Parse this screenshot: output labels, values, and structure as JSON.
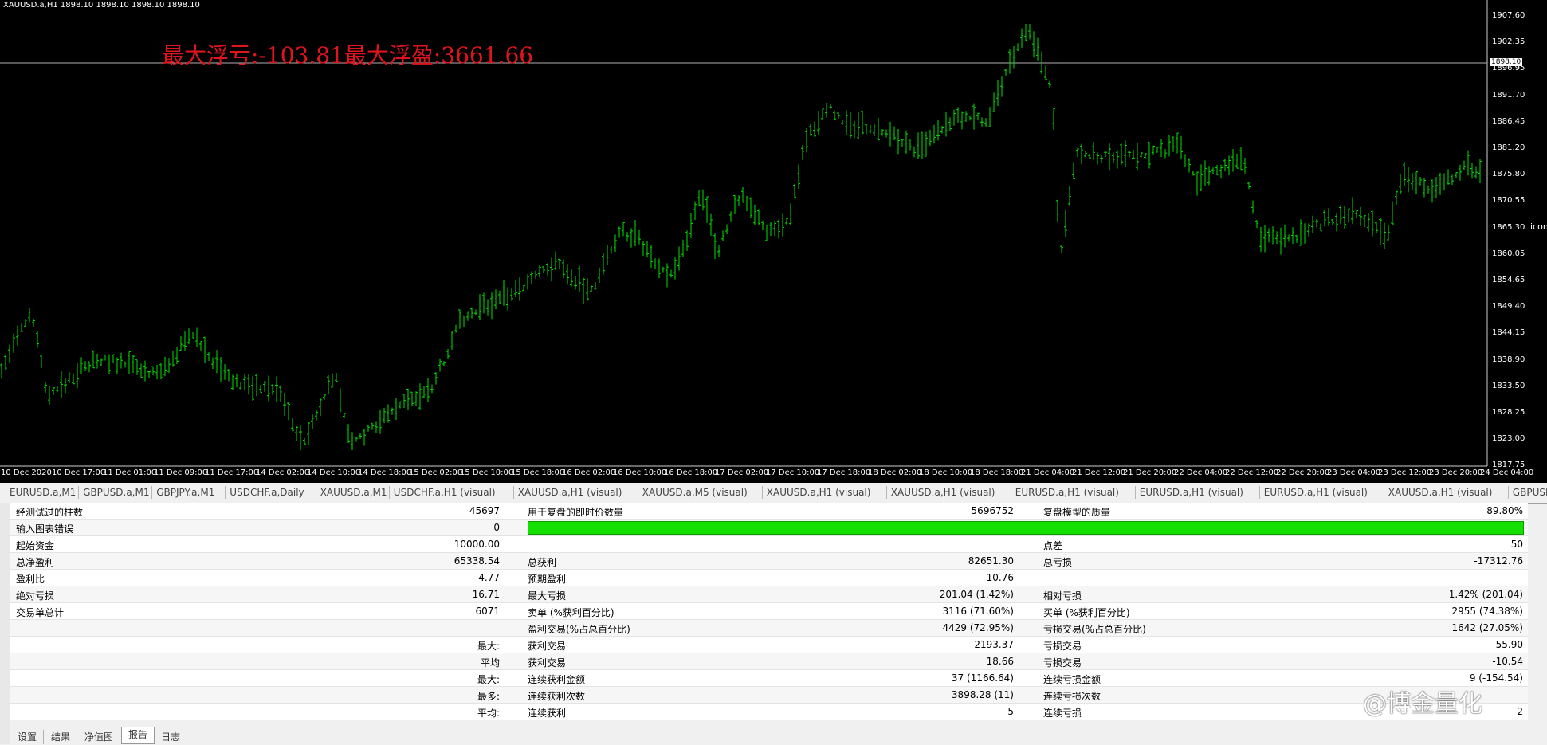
{
  "chart": {
    "header": "XAUUSD.a,H1  1898.10 1898.10 1898.10 1898.10",
    "overlay_text": "最大浮亏:-103.81最大浮盈:3661.66",
    "current_price": "1898.10",
    "price_ticks": [
      "1907.60",
      "1902.35",
      "1896.95",
      "1891.70",
      "1886.45",
      "1881.20",
      "1875.80",
      "1870.55",
      "1865.30",
      "1860.05",
      "1854.65",
      "1849.40",
      "1844.15",
      "1838.90",
      "1833.50",
      "1828.25",
      "1823.00",
      "1817.75"
    ],
    "time_ticks": [
      "10 Dec 2020",
      "10 Dec 17:00",
      "11 Dec 01:00",
      "11 Dec 09:00",
      "11 Dec 17:00",
      "14 Dec 02:00",
      "14 Dec 10:00",
      "14 Dec 18:00",
      "15 Dec 02:00",
      "15 Dec 10:00",
      "15 Dec 18:00",
      "16 Dec 02:00",
      "16 Dec 10:00",
      "16 Dec 18:00",
      "17 Dec 02:00",
      "17 Dec 10:00",
      "17 Dec 18:00",
      "18 Dec 02:00",
      "18 Dec 10:00",
      "18 Dec 18:00",
      "21 Dec 04:00",
      "21 Dec 12:00",
      "21 Dec 20:00",
      "22 Dec 04:00",
      "22 Dec 12:00",
      "22 Dec 20:00",
      "23 Dec 04:00",
      "23 Dec 12:00",
      "23 Dec 20:00",
      "24 Dec 04:00"
    ],
    "bar_color": "#00e000",
    "right_fragment": "icon"
  },
  "chart_tabs": [
    "EURUSD.a,M1",
    "GBPUSD.a,M1",
    "GBPJPY.a,M1",
    "USDCHF.a,Daily",
    "XAUUSD.a,M1",
    "USDCHF.a,H1 (visual)",
    "XAUUSD.a,H1 (visual)",
    "XAUUSD.a,M5 (visual)",
    "XAUUSD.a,H1 (visual)",
    "XAUUSD.a,H1 (visual)",
    "EURUSD.a,H1 (visual)",
    "EURUSD.a,H1 (visual)",
    "EURUSD.a,H1 (visual)",
    "XAUUSD.a,H1 (visual)",
    "GBPUSE"
  ],
  "report": {
    "rows": [
      {
        "l1": "经测试过的柱数",
        "v1": "45697",
        "l2": "用于复盘的即时价数量",
        "v2": "5696752",
        "l3": "复盘模型的质量",
        "v3": "89.80%"
      },
      {
        "l1": "输入图表错误",
        "v1": "0",
        "l2": "",
        "v2": "",
        "l3": "",
        "v3": "",
        "bar": true
      },
      {
        "l1": "起始资金",
        "v1": "10000.00",
        "l2": "",
        "v2": "",
        "l3": "点差",
        "v3": "50"
      },
      {
        "l1": "总净盈利",
        "v1": "65338.54",
        "l2": "总获利",
        "v2": "82651.30",
        "l3": "总亏损",
        "v3": "-17312.76"
      },
      {
        "l1": "盈利比",
        "v1": "4.77",
        "l2": "预期盈利",
        "v2": "10.76",
        "l3": "",
        "v3": ""
      },
      {
        "l1": "绝对亏损",
        "v1": "16.71",
        "l2": "最大亏损",
        "v2": "201.04 (1.42%)",
        "l3": "相对亏损",
        "v3": "1.42% (201.04)"
      },
      {
        "l1": "交易单总计",
        "v1": "6071",
        "l2": "卖单 (%获利百分比)",
        "v2": "3116 (71.60%)",
        "l3": "买单 (%获利百分比)",
        "v3": "2955 (74.38%)"
      },
      {
        "l1": "",
        "v1": "",
        "l2": "盈利交易(%占总百分比)",
        "v2": "4429 (72.95%)",
        "l3": "亏损交易(%占总百分比)",
        "v3": "1642 (27.05%)"
      },
      {
        "l1": "",
        "v1": "最大:",
        "l2": "获利交易",
        "v2": "2193.37",
        "l3": "亏损交易",
        "v3": "-55.90"
      },
      {
        "l1": "",
        "v1": "平均",
        "l2": "获利交易",
        "v2": "18.66",
        "l3": "亏损交易",
        "v3": "-10.54"
      },
      {
        "l1": "",
        "v1": "最大:",
        "l2": "连续获利金额",
        "v2": "37 (1166.64)",
        "l3": "连续亏损金额",
        "v3": "9 (-154.54)"
      },
      {
        "l1": "",
        "v1": "最多:",
        "l2": "连续获利次数",
        "v2": "3898.28 (11)",
        "l3": "连续亏损次数",
        "v3": ""
      },
      {
        "l1": "",
        "v1": "平均:",
        "l2": "连续获利",
        "v2": "5",
        "l3": "连续亏损",
        "v3": "2"
      }
    ]
  },
  "bottom_tabs": [
    "设置",
    "结果",
    "净值图",
    "报告",
    "日志"
  ],
  "active_bottom_tab": "报告",
  "watermark": "@博金量化",
  "accent_green": "#14e000"
}
